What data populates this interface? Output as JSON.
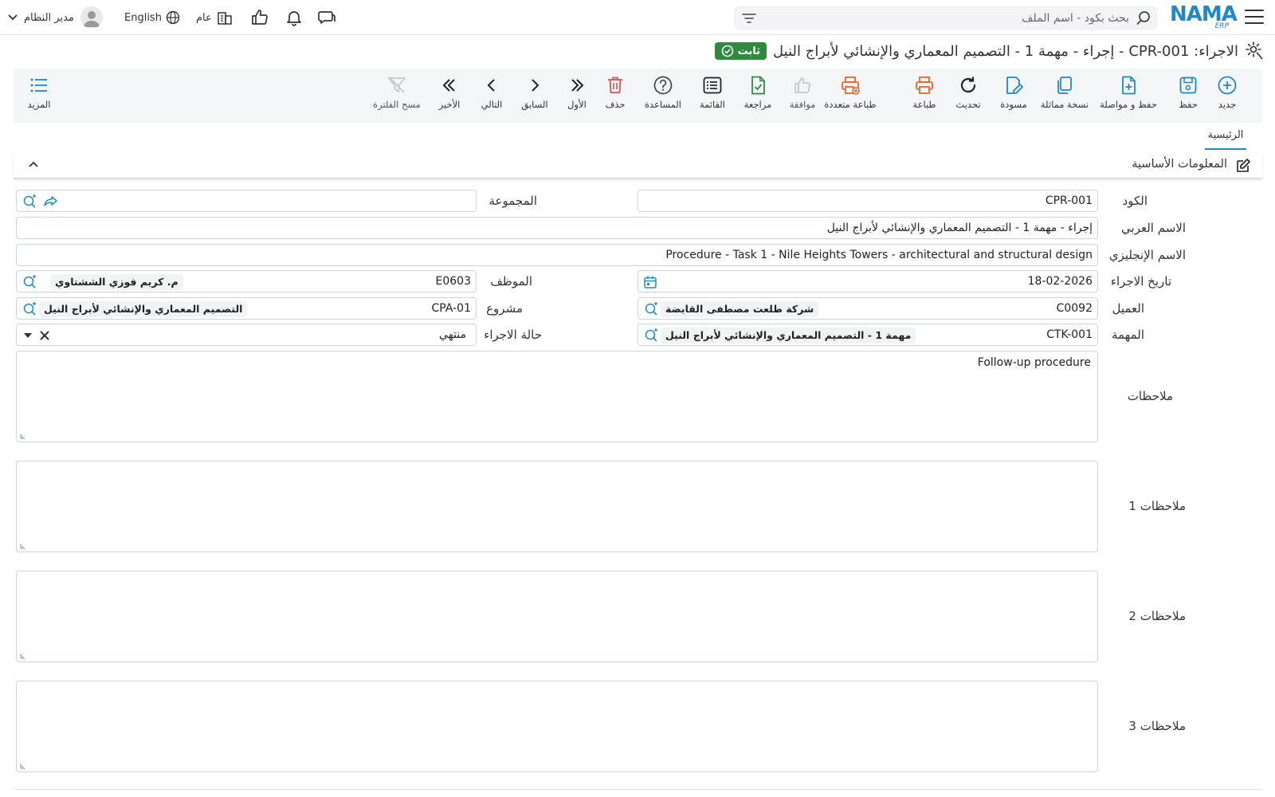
{
  "header": {
    "logo_text": "NAMA",
    "logo_sub": "ERP",
    "search_placeholder": "بحث بكود - اسم الملف",
    "language": "English",
    "branch": "عام",
    "user_name": "مدير النظام"
  },
  "title": {
    "text": "الاجراء: CPR-001 - إجراء - مهمة 1 - التصميم المعماري والإنشائي لأبراج النيل",
    "status": "ثابت"
  },
  "toolbar": {
    "new": "جديد",
    "save": "حفظ",
    "save_continue": "حفظ و مواصلة",
    "duplicate": "نسخة مماثلة",
    "draft": "مسودة",
    "refresh": "تحديث",
    "print": "طباعة",
    "multi_print": "طباعة متعددة",
    "approve": "موافقة",
    "review": "مراجعة",
    "list": "القائمة",
    "help": "المساعدة",
    "delete": "حذف",
    "first": "الأول",
    "previous": "السابق",
    "next": "التالي",
    "last": "الأخير",
    "clear_filter": "مسح الفلترة",
    "more": "المزيد"
  },
  "tabs": {
    "main": "الرئيسية"
  },
  "section": {
    "title": "المعلومات الأساسية"
  },
  "form": {
    "code_label": "الكود",
    "code": "CPR-001",
    "group_label": "المجموعة",
    "group": "",
    "arabic_name_label": "الاسم العربي",
    "arabic_name": "إجراء - مهمة 1 - التصميم المعماري والإنشائي لأبراج النيل",
    "english_name_label": "الاسم الإنجليزي",
    "english_name": "Procedure - Task 1 - Nile Heights Towers - architectural and structural design",
    "date_label": "تاريخ الاجراء",
    "date": "18-02-2026",
    "employee_label": "الموظف",
    "employee_code": "E0603",
    "employee_name": "م. كريم فوزي الششتاوي",
    "customer_label": "العميل",
    "customer_code": "C0092",
    "customer_name": "شركة طلعت مصطفى القابضة",
    "project_label": "مشروع",
    "project_code": "CPA-01",
    "project_name": "التصميم المعماري والإنشائي لأبراج النيل",
    "task_label": "المهمة",
    "task_code": "CTK-001",
    "task_name": "مهمة 1 - التصميم المعماري والإنشائي لأبراج النيل",
    "status_label": "حالة الاجراء",
    "status": "منتهي",
    "notes_label": "ملاحظات",
    "notes": "Follow-up procedure",
    "notes1_label": "ملاحظات 1",
    "notes1": "",
    "notes2_label": "ملاحظات 2",
    "notes2": "",
    "notes3_label": "ملاحظات 3",
    "notes3": ""
  },
  "colors": {
    "accent": "#1e88c9",
    "success": "#2e8b3e",
    "danger": "#d9534f",
    "print": "#e8652b"
  },
  "icons": [
    "menu-icon",
    "search-icon",
    "filter-icon",
    "chat-icon",
    "bell-icon",
    "thumbs-up-icon",
    "building-icon",
    "globe-icon",
    "avatar-icon",
    "gear-icon",
    "check-circle-icon",
    "edit-icon",
    "chevron-up-icon",
    "lookup-icon",
    "share-icon",
    "calendar-icon",
    "clear-icon",
    "caret-down-icon"
  ]
}
